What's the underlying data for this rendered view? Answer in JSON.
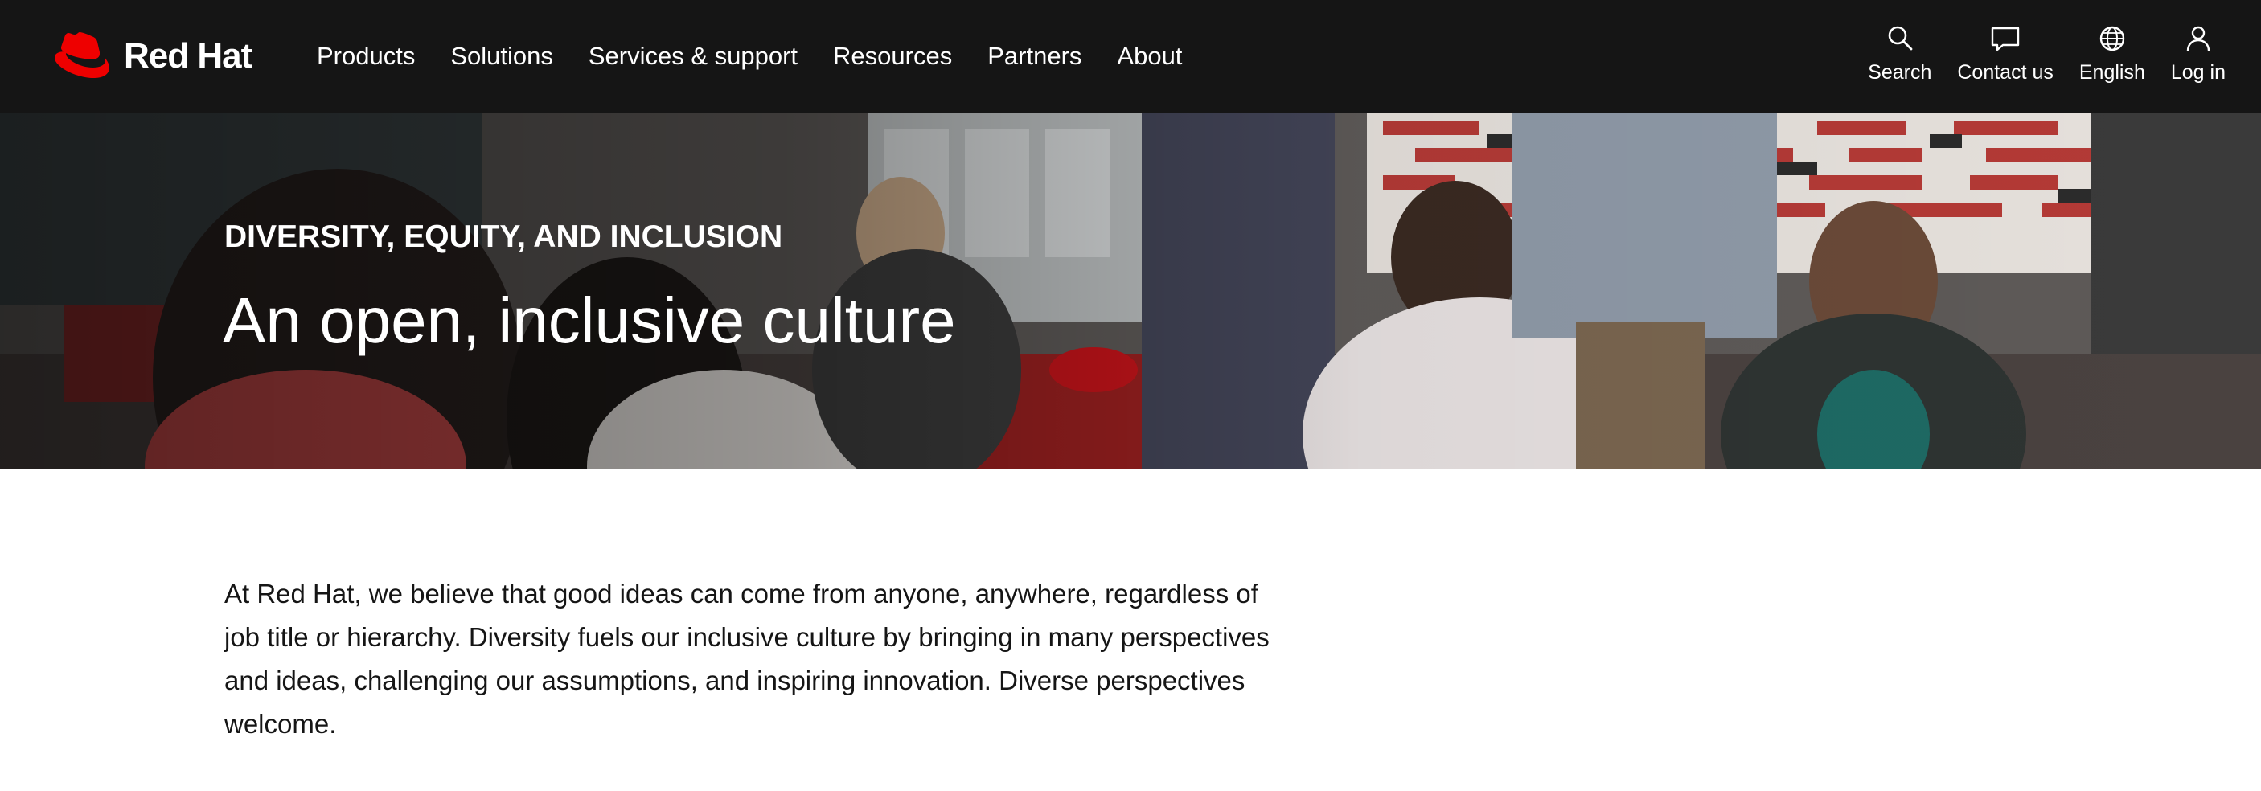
{
  "brand": {
    "name": "Red Hat",
    "color": "#ee0000",
    "nav_bg": "#151515"
  },
  "nav": {
    "items": [
      "Products",
      "Solutions",
      "Services & support",
      "Resources",
      "Partners",
      "About"
    ]
  },
  "utility": {
    "search": {
      "label": "Search",
      "icon": "search-icon"
    },
    "contact": {
      "label": "Contact us",
      "icon": "chat-icon"
    },
    "language": {
      "label": "English",
      "icon": "globe-icon"
    },
    "login": {
      "label": "Log in",
      "icon": "user-icon"
    }
  },
  "hero": {
    "eyebrow": "DIVERSITY, EQUITY, AND INCLUSION",
    "title": "An open, inclusive culture"
  },
  "intro": {
    "text": "At Red Hat, we believe that good ideas can come from anyone, anywhere, regardless of job title or hierarchy. Diversity fuels our inclusive culture by bringing in many perspectives and ideas, challenging our assumptions, and inspiring innovation. Diverse perspectives welcome."
  }
}
